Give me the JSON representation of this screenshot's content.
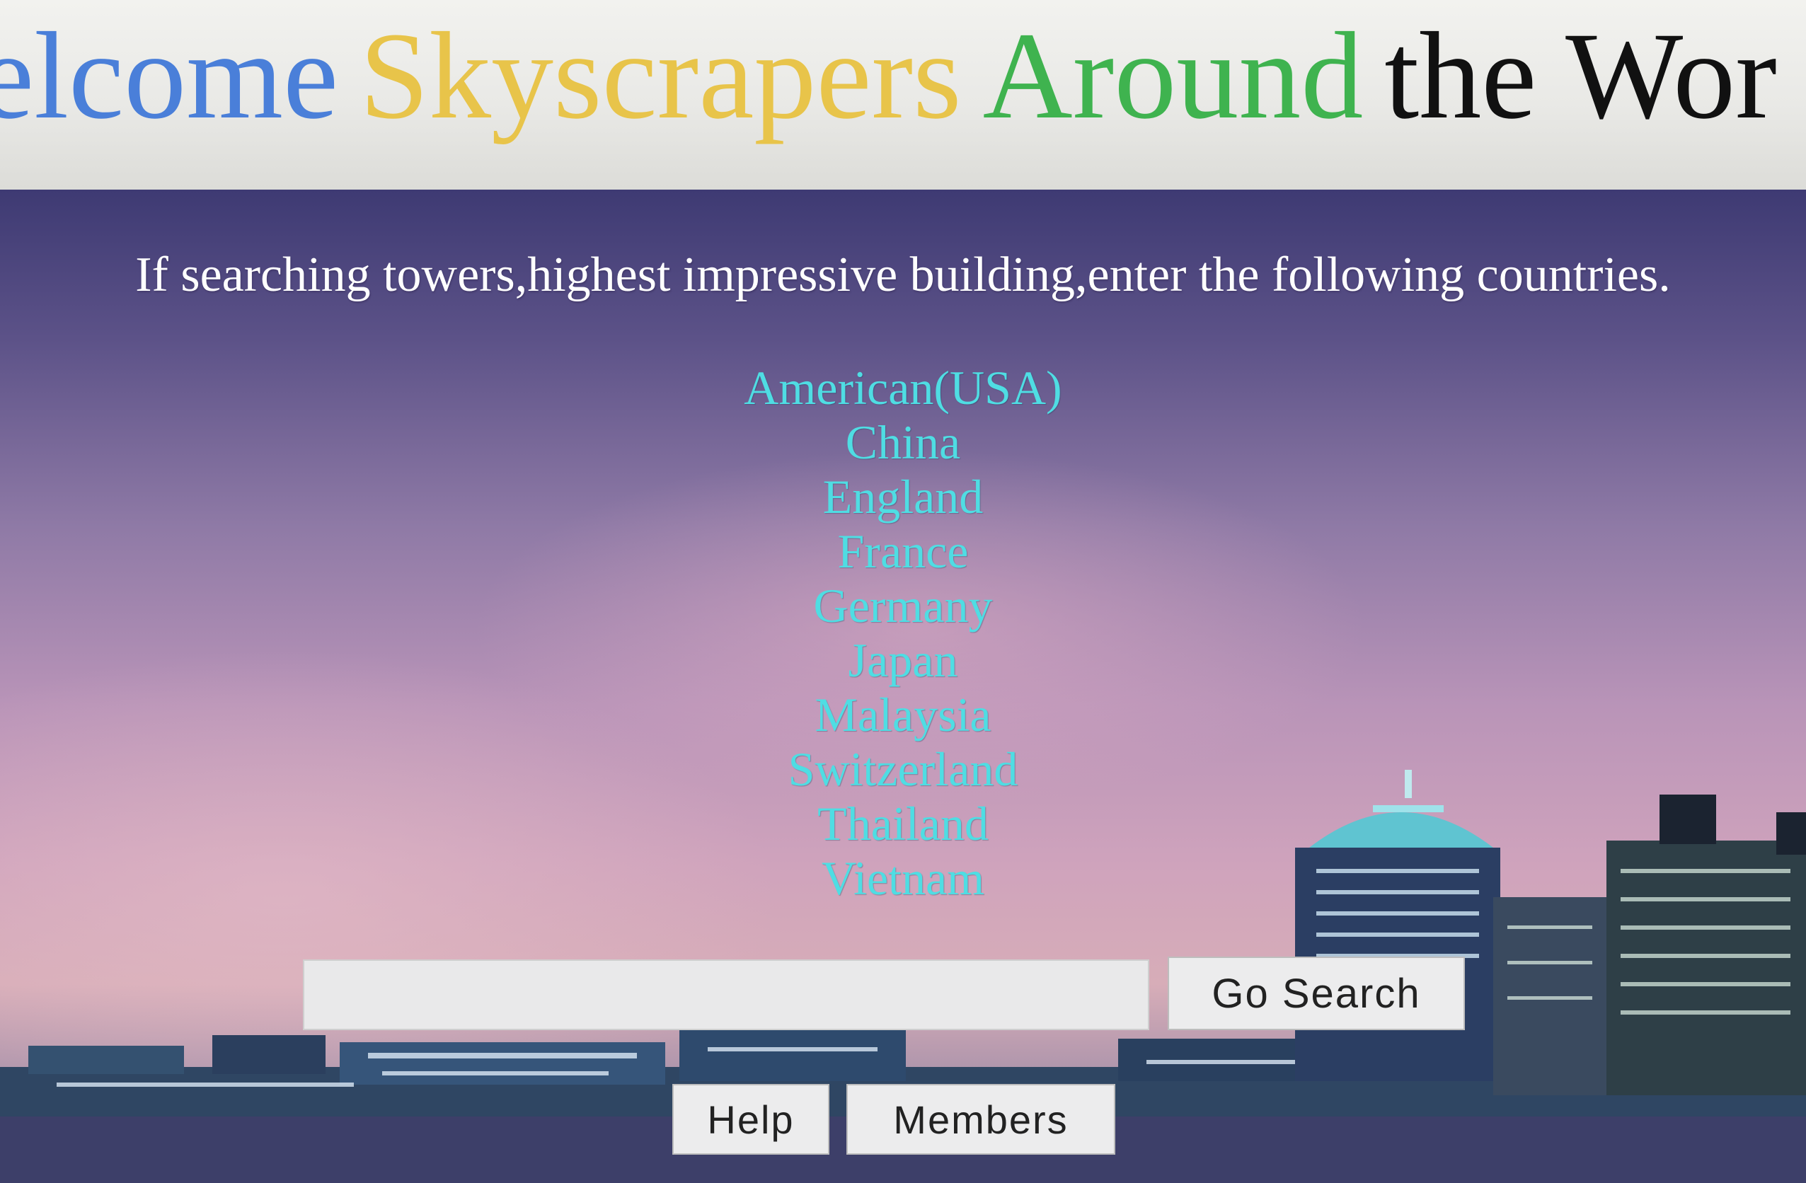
{
  "header": {
    "title_parts": [
      "elcome",
      "Skyscrapers",
      "Around",
      "the Wor"
    ],
    "colors": [
      "#4a7fd9",
      "#e8c44a",
      "#3fb34f",
      "#111111"
    ]
  },
  "main": {
    "intro_text": "If searching towers,highest impressive building,enter the following countries.",
    "countries": [
      "American(USA)",
      "China",
      "England",
      "France",
      "Germany",
      "Japan",
      "Malaysia",
      "Switzerland",
      "Thailand",
      "Vietnam"
    ],
    "country_color": "#4fdde3"
  },
  "search": {
    "value": "",
    "placeholder": "",
    "button_label": "Go Search"
  },
  "footer_buttons": {
    "help_label": "Help",
    "members_label": "Members"
  }
}
